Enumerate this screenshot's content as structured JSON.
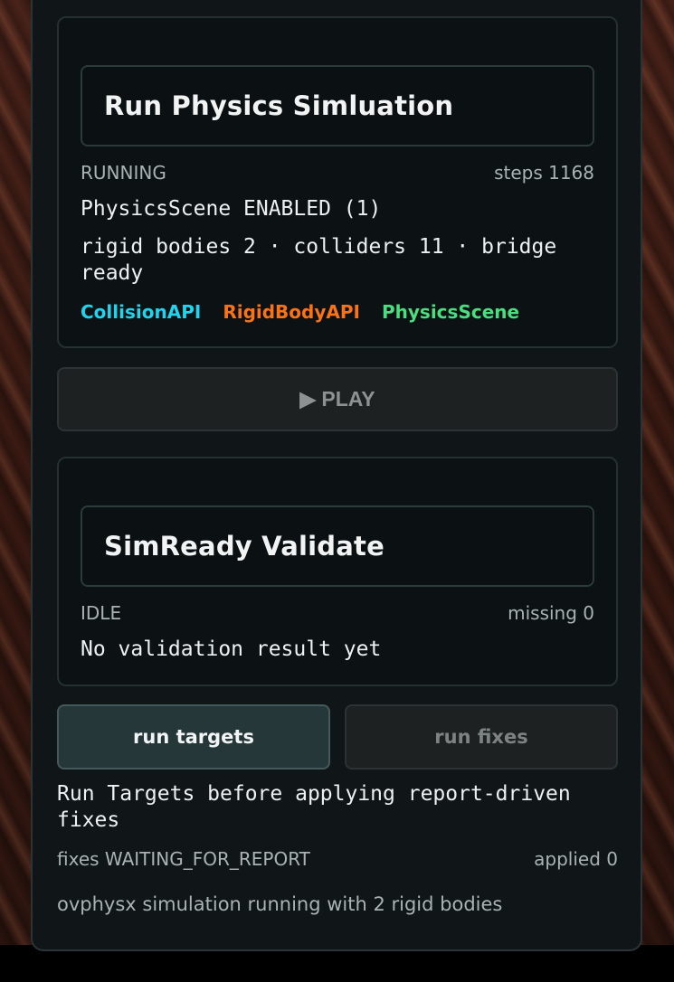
{
  "physics": {
    "title": "Run Physics Simluation",
    "status": "RUNNING",
    "steps": "steps 1168",
    "scene_line": "PhysicsScene ENABLED (1)",
    "bodies_line": "rigid bodies 2 · colliders 11 · bridge ready",
    "tags": [
      {
        "label": "CollisionAPI",
        "color": "#22d3ee"
      },
      {
        "label": "RigidBodyAPI",
        "color": "#f97316"
      },
      {
        "label": "PhysicsScene",
        "color": "#4ade80"
      }
    ],
    "play_label": "▶ PLAY"
  },
  "simready": {
    "title": "SimReady Validate",
    "status": "IDLE",
    "missing": "missing 0",
    "result": "No validation result yet"
  },
  "actions": {
    "run_targets_label": "run targets",
    "run_fixes_label": "run fixes",
    "hint": "Run Targets before applying report-driven fixes",
    "fixes_status": "fixes WAITING_FOR_REPORT",
    "applied": "applied 0"
  },
  "footer": {
    "message": "ovphysx simulation running with 2 rigid bodies"
  }
}
